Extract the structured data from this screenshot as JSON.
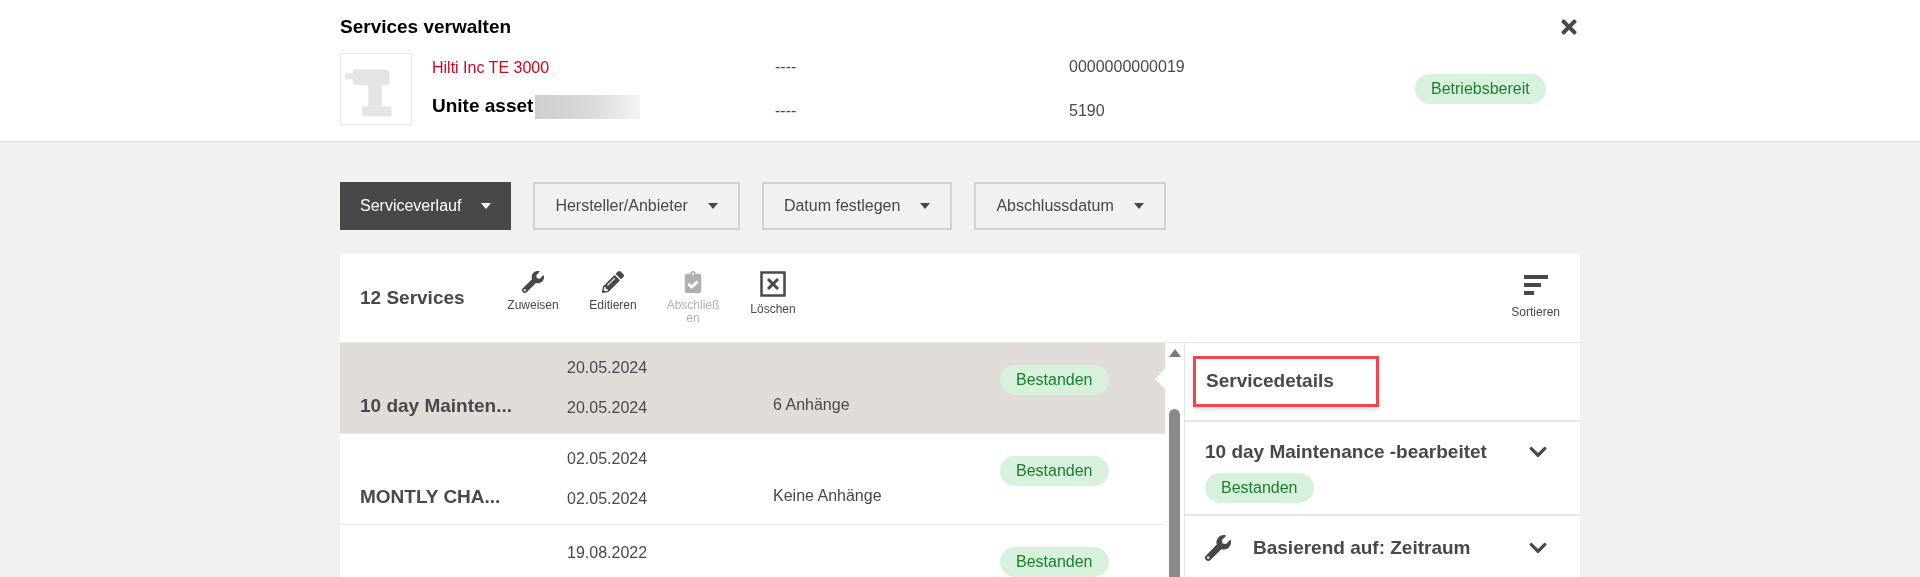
{
  "header": {
    "title": "Services verwalten",
    "asset": {
      "name": "Hilti Inc TE 3000",
      "label": "Unite asset",
      "field_1": "----",
      "field_2": "----",
      "serial": "0000000000019",
      "number": "5190",
      "status": "Betriebsbereit"
    }
  },
  "filters": [
    {
      "label": "Serviceverlauf",
      "selected": true
    },
    {
      "label": "Hersteller/Anbieter",
      "selected": false
    },
    {
      "label": "Datum festlegen",
      "selected": false
    },
    {
      "label": "Abschlussdatum",
      "selected": false
    }
  ],
  "toolbar": {
    "count": "12 Services",
    "actions": [
      {
        "kind": "wrench",
        "label": "Zuweisen",
        "disabled": false
      },
      {
        "kind": "pencil",
        "label": "Editieren",
        "disabled": false
      },
      {
        "kind": "clipboard",
        "label": "Abschließen",
        "disabled": true
      },
      {
        "kind": "delete",
        "label": "Löschen",
        "disabled": false
      }
    ],
    "sort": "Sortieren"
  },
  "services": [
    {
      "name": "10 day Mainten...",
      "date_1": "20.05.2024",
      "date_2": "20.05.2024",
      "attachments": "6 Anhänge",
      "status": "Bestanden",
      "selected": true
    },
    {
      "name": "MONTLY CHA...",
      "date_1": "02.05.2024",
      "date_2": "02.05.2024",
      "attachments": "Keine Anhänge",
      "status": "Bestanden",
      "selected": false
    },
    {
      "date_1": "19.08.2022",
      "status": "Bestanden",
      "selected": false
    }
  ],
  "details": {
    "title": "Servicedetails",
    "service": {
      "name": "10 day Maintenance -bearbeitet",
      "status": "Bestanden"
    },
    "basis": "Basierend auf: Zeitraum"
  }
}
